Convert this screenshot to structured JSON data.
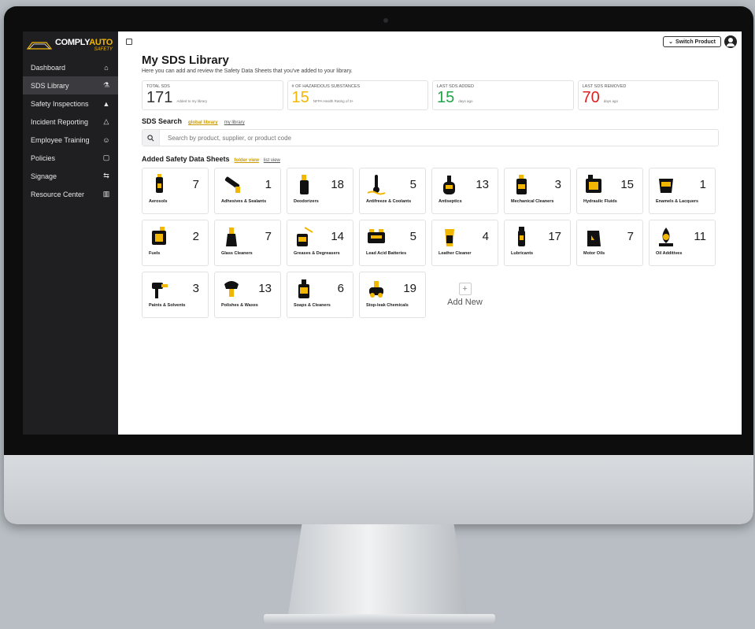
{
  "brand": {
    "name_white": "COMPLY",
    "name_yellow": "AUTO",
    "sub": "SAFETY"
  },
  "sidebar": {
    "items": [
      {
        "label": "Dashboard",
        "icon": "home-icon"
      },
      {
        "label": "SDS Library",
        "icon": "flask-icon"
      },
      {
        "label": "Safety Inspections",
        "icon": "car-icon"
      },
      {
        "label": "Incident Reporting",
        "icon": "warning-icon"
      },
      {
        "label": "Employee Training",
        "icon": "users-icon"
      },
      {
        "label": "Policies",
        "icon": "clipboard-icon"
      },
      {
        "label": "Signage",
        "icon": "signpost-icon"
      },
      {
        "label": "Resource Center",
        "icon": "book-icon"
      }
    ]
  },
  "topbar": {
    "switch_label": "Switch Product"
  },
  "page": {
    "title": "My SDS Library",
    "subtitle": "Here you can add and review the Safety Data Sheets that you've added to your library."
  },
  "stats": [
    {
      "label": "TOTAL SDS",
      "value": "171",
      "note": "Added to my library",
      "color": "#333333"
    },
    {
      "label": "# OF HAZARDOUS SUBSTANCES",
      "value": "15",
      "note": "NFPA Health Rating of 3+",
      "color": "#f2b705"
    },
    {
      "label": "LAST SDS ADDED",
      "value": "15",
      "note": "days ago",
      "color": "#22a34a"
    },
    {
      "label": "LAST SDS REMOVED",
      "value": "70",
      "note": "days ago",
      "color": "#e02020"
    }
  ],
  "search": {
    "title": "SDS Search",
    "link_global": "global library",
    "link_mine": "my library",
    "placeholder": "Search by product, supplier, or product code"
  },
  "added": {
    "title": "Added Safety Data Sheets",
    "link_folder": "folder view",
    "link_list": "list view",
    "add_new_label": "Add New",
    "categories": [
      {
        "label": "Aerosols",
        "count": "7",
        "icon": "aerosol-can-icon"
      },
      {
        "label": "Adhesives & Sealants",
        "count": "1",
        "icon": "caulk-gun-icon"
      },
      {
        "label": "Deodorizers",
        "count": "18",
        "icon": "spray-bottle-icon"
      },
      {
        "label": "Antifreeze & Coolants",
        "count": "5",
        "icon": "thermometer-icon"
      },
      {
        "label": "Antiseptics",
        "count": "13",
        "icon": "soap-dispenser-icon"
      },
      {
        "label": "Mechanical Cleaners",
        "count": "3",
        "icon": "cleaner-bottle-icon"
      },
      {
        "label": "Hydraulic Fluids",
        "count": "15",
        "icon": "jerrycan-icon"
      },
      {
        "label": "Enamels & Lacquers",
        "count": "1",
        "icon": "paint-bucket-icon"
      },
      {
        "label": "Fuels",
        "count": "2",
        "icon": "fuel-can-icon"
      },
      {
        "label": "Glass Cleaners",
        "count": "7",
        "icon": "glass-spray-icon"
      },
      {
        "label": "Greases & Degreasers",
        "count": "14",
        "icon": "grease-can-icon"
      },
      {
        "label": "Lead Acid Batteries",
        "count": "5",
        "icon": "battery-icon"
      },
      {
        "label": "Leather Cleaner",
        "count": "4",
        "icon": "trigger-spray-icon"
      },
      {
        "label": "Lubricants",
        "count": "17",
        "icon": "lubricant-bottle-icon"
      },
      {
        "label": "Motor Oils",
        "count": "7",
        "icon": "oil-jug-icon"
      },
      {
        "label": "Oil Additives",
        "count": "11",
        "icon": "oil-drop-icon"
      },
      {
        "label": "Paints & Solvents",
        "count": "3",
        "icon": "spray-gun-icon"
      },
      {
        "label": "Polishes & Waxes",
        "count": "13",
        "icon": "polisher-icon"
      },
      {
        "label": "Soaps & Cleaners",
        "count": "6",
        "icon": "soap-bottle-icon"
      },
      {
        "label": "Stop-leak Chemicals",
        "count": "19",
        "icon": "stopleak-icon"
      }
    ]
  },
  "colors": {
    "accent": "#f2b705",
    "sidebar_bg": "#1f1f22",
    "sidebar_active": "#3a3a3f"
  }
}
